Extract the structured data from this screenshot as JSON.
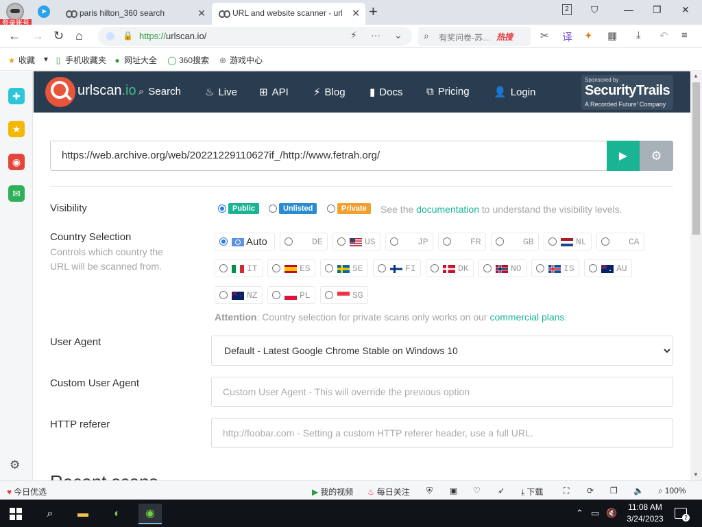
{
  "browser": {
    "login_badge": "登录账号",
    "tabs": [
      {
        "title": "paris hilton_360 search"
      },
      {
        "title": "URL and website scanner - urlscan.io"
      }
    ],
    "new_tab": "+",
    "tab_count": "2",
    "address": {
      "scheme": "https://",
      "rest": "urlscan.io/"
    },
    "search": {
      "placeholder": "有奖问卷-苏…",
      "hot_label": "热搜"
    },
    "bookmarks": [
      {
        "label": "收藏"
      },
      {
        "label": "手机收藏夹"
      },
      {
        "label": "网址大全"
      },
      {
        "label": "360搜索"
      },
      {
        "label": "游戏中心"
      }
    ]
  },
  "nav": {
    "brand": "urlscan",
    "brand_suffix": ".io",
    "links": [
      {
        "label": "Search",
        "icon": "search-icon"
      },
      {
        "label": "Live",
        "icon": "fire-icon"
      },
      {
        "label": "API",
        "icon": "sitemap-icon"
      },
      {
        "label": "Blog",
        "icon": "bolt-icon"
      },
      {
        "label": "Docs",
        "icon": "bookmark-icon"
      },
      {
        "label": "Pricing",
        "icon": "external-link-icon"
      },
      {
        "label": "Login",
        "icon": "user-icon"
      }
    ],
    "sponsor": {
      "line1": "Sponsored by",
      "name": "SecurityTrails",
      "line3": "A Recorded Future' Company"
    }
  },
  "scan": {
    "url": "https://web.archive.org/web/20221229110627if_/http://www.fetrah.org/"
  },
  "visibility": {
    "label": "Visibility",
    "options": [
      {
        "label": "Public",
        "color": "#1ab394",
        "selected": true
      },
      {
        "label": "Unlisted",
        "color": "#2a8bd0",
        "selected": false
      },
      {
        "label": "Private",
        "color": "#f0a030",
        "selected": false
      }
    ],
    "note_pre": "See the",
    "note_link": "documentation",
    "note_post": "to understand the visibility levels."
  },
  "country": {
    "label": "Country Selection",
    "sublabel": "Controls which country the URL will be scanned from.",
    "options": [
      {
        "code": "Auto",
        "selected": true
      },
      {
        "code": "DE"
      },
      {
        "code": "US"
      },
      {
        "code": "JP"
      },
      {
        "code": "FR"
      },
      {
        "code": "GB"
      },
      {
        "code": "NL"
      },
      {
        "code": "CA"
      },
      {
        "code": "IT"
      },
      {
        "code": "ES"
      },
      {
        "code": "SE"
      },
      {
        "code": "FI"
      },
      {
        "code": "DK"
      },
      {
        "code": "NO"
      },
      {
        "code": "IS"
      },
      {
        "code": "AU"
      },
      {
        "code": "NZ"
      },
      {
        "code": "PL"
      },
      {
        "code": "SG"
      }
    ],
    "attention_label": "Attention",
    "attention_text": ": Country selection for private scans only works on our",
    "attention_link": "commercial plans",
    "attention_end": "."
  },
  "user_agent": {
    "label": "User Agent",
    "selected": "Default - Latest Google Chrome Stable on Windows 10"
  },
  "custom_ua": {
    "label": "Custom User Agent",
    "placeholder": "Custom User Agent - This will override the previous option"
  },
  "referer": {
    "label": "HTTP referer",
    "placeholder": "http://foobar.com - Setting a custom HTTP referer header, use a full URL."
  },
  "recent": {
    "title": "Recent scans"
  },
  "statusbar": {
    "left": "今日优选",
    "video": "我的视频",
    "follow": "每日关注",
    "download": "下载",
    "zoom": "100%"
  },
  "taskbar": {
    "time": "11:08 AM",
    "date": "3/24/2023",
    "notifications": "2"
  }
}
